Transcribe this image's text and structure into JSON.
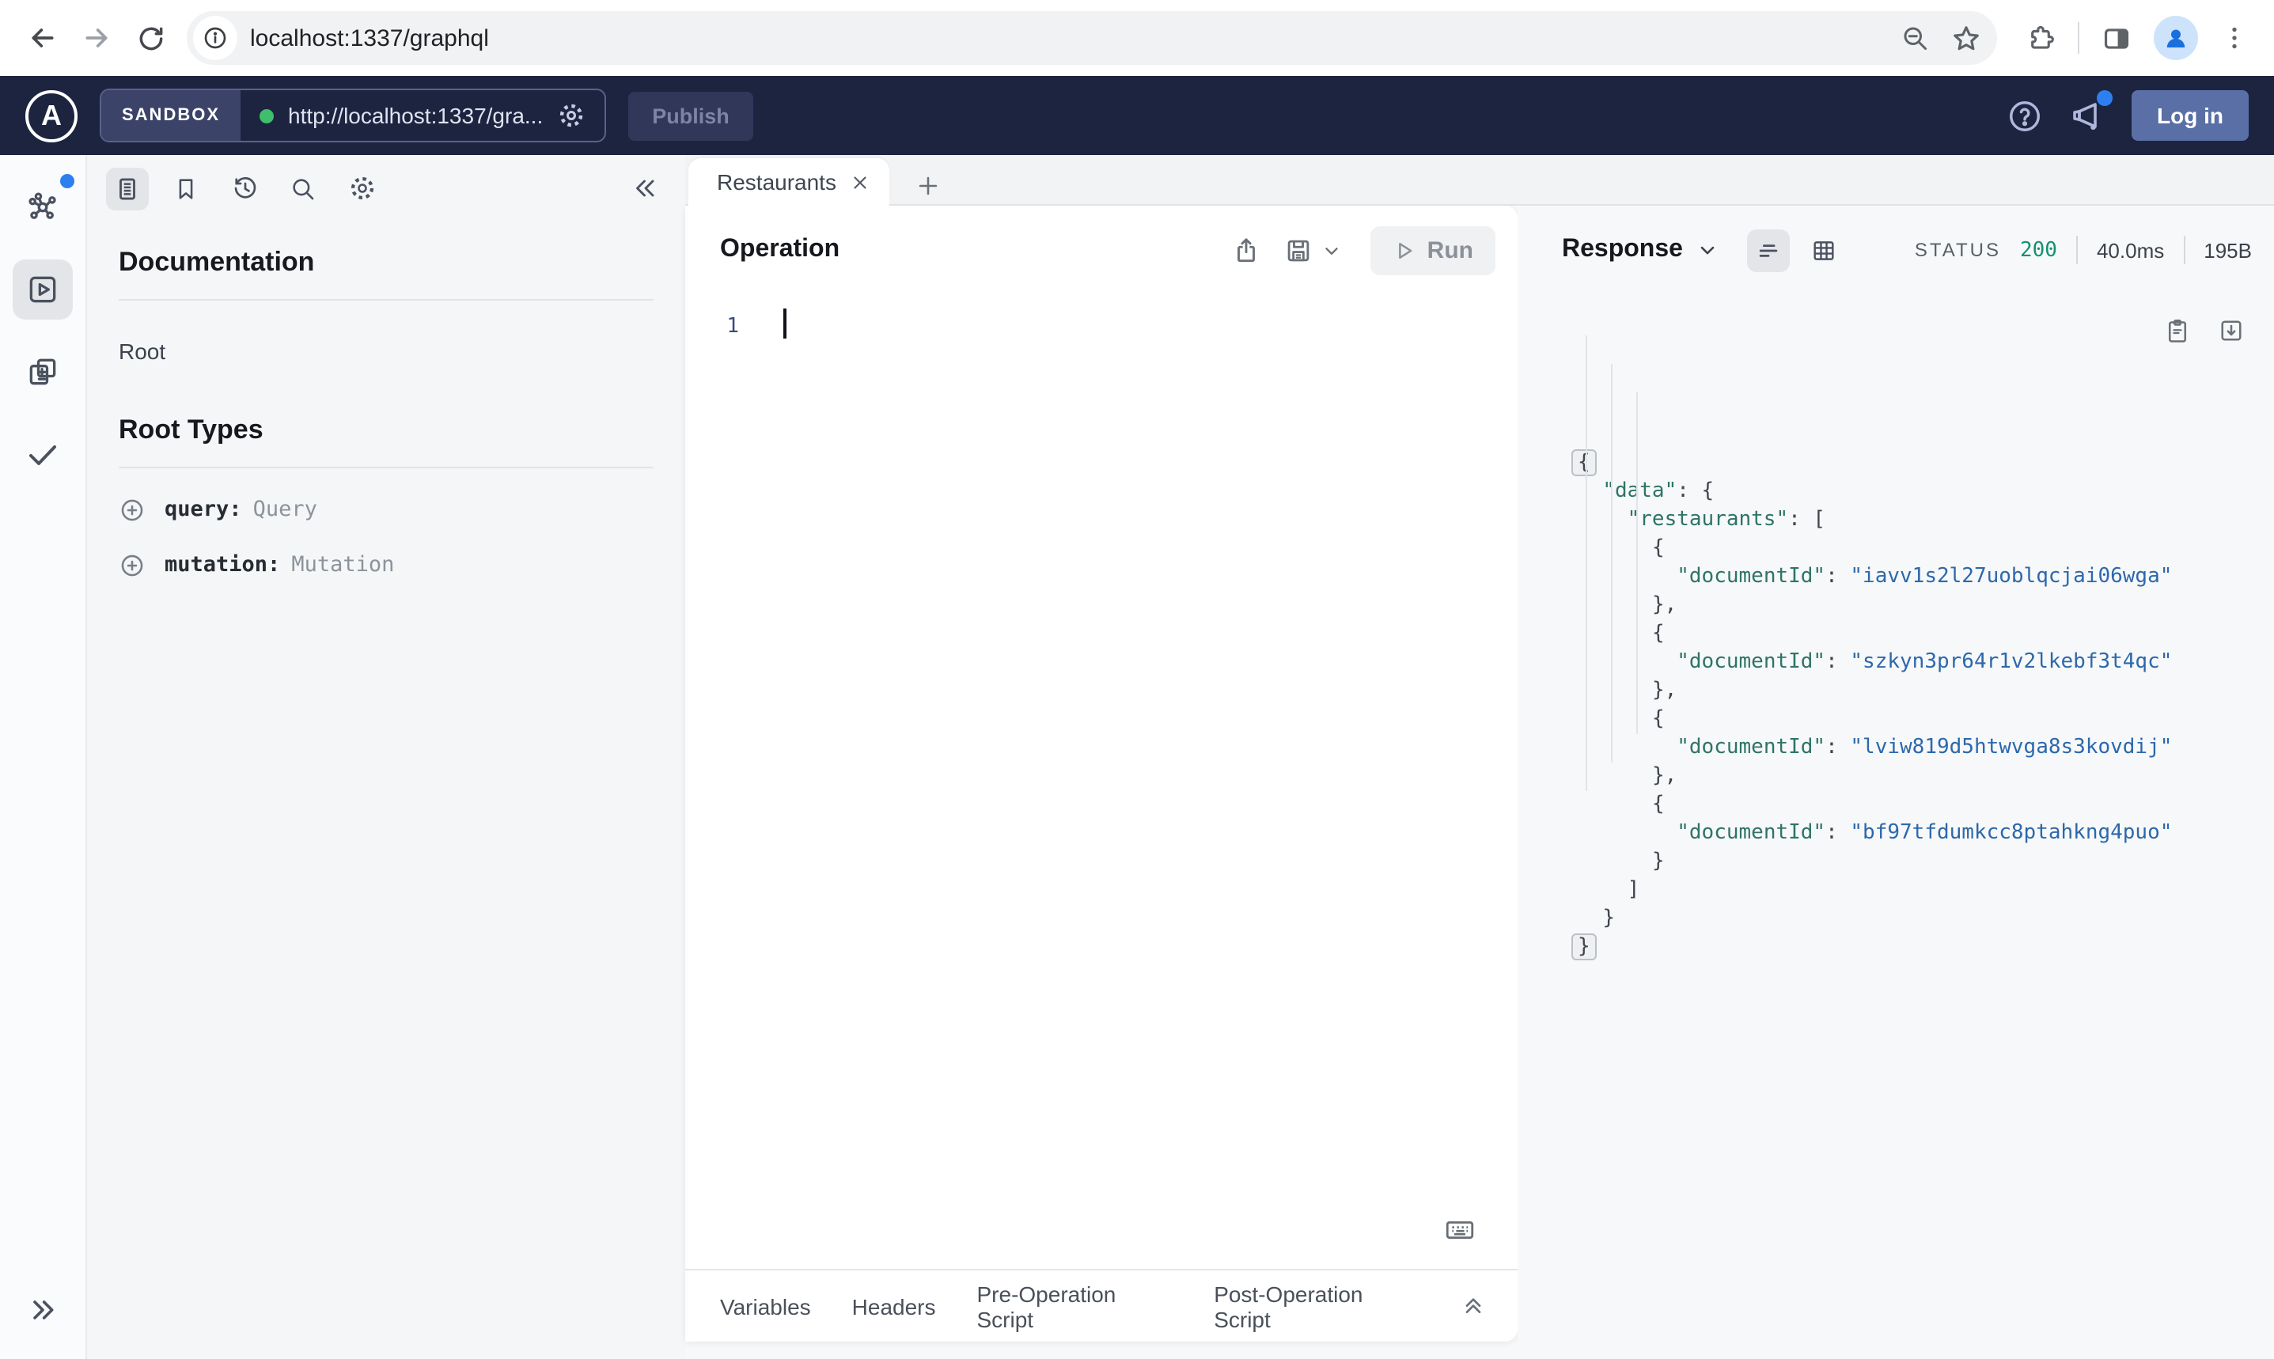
{
  "browser": {
    "url": "localhost:1337/graphql"
  },
  "apollo_toolbar": {
    "sandbox_label": "SANDBOX",
    "endpoint": "http://localhost:1337/gra...",
    "publish_label": "Publish",
    "login_label": "Log in"
  },
  "doc_panel": {
    "title": "Documentation",
    "root_item": "Root",
    "root_types_title": "Root Types",
    "entries": [
      {
        "field": "query:",
        "type": "Query"
      },
      {
        "field": "mutation:",
        "type": "Mutation"
      }
    ]
  },
  "tabs": {
    "active_label": "Restaurants"
  },
  "operation": {
    "title": "Operation",
    "run_label": "Run",
    "line_number": "1"
  },
  "response": {
    "title": "Response",
    "status_label": "STATUS",
    "status_code": "200",
    "duration": "40.0ms",
    "size": "195B",
    "lines": [
      [
        [
          "fold",
          "{"
        ]
      ],
      [
        [
          "pre",
          "  "
        ],
        [
          "key",
          "\"data\""
        ],
        [
          "punc",
          ": {"
        ]
      ],
      [
        [
          "pre",
          "    "
        ],
        [
          "key",
          "\"restaurants\""
        ],
        [
          "punc",
          ": ["
        ]
      ],
      [
        [
          "pre",
          "      "
        ],
        [
          "punc",
          "{"
        ]
      ],
      [
        [
          "pre",
          "        "
        ],
        [
          "key",
          "\"documentId\""
        ],
        [
          "punc",
          ": "
        ],
        [
          "val",
          "\"iavv1s2l27uoblqcjai06wga\""
        ]
      ],
      [
        [
          "pre",
          "      "
        ],
        [
          "punc",
          "},"
        ]
      ],
      [
        [
          "pre",
          "      "
        ],
        [
          "punc",
          "{"
        ]
      ],
      [
        [
          "pre",
          "        "
        ],
        [
          "key",
          "\"documentId\""
        ],
        [
          "punc",
          ": "
        ],
        [
          "val",
          "\"szkyn3pr64r1v2lkebf3t4qc\""
        ]
      ],
      [
        [
          "pre",
          "      "
        ],
        [
          "punc",
          "},"
        ]
      ],
      [
        [
          "pre",
          "      "
        ],
        [
          "punc",
          "{"
        ]
      ],
      [
        [
          "pre",
          "        "
        ],
        [
          "key",
          "\"documentId\""
        ],
        [
          "punc",
          ": "
        ],
        [
          "val",
          "\"lviw819d5htwvga8s3kovdij\""
        ]
      ],
      [
        [
          "pre",
          "      "
        ],
        [
          "punc",
          "},"
        ]
      ],
      [
        [
          "pre",
          "      "
        ],
        [
          "punc",
          "{"
        ]
      ],
      [
        [
          "pre",
          "        "
        ],
        [
          "key",
          "\"documentId\""
        ],
        [
          "punc",
          ": "
        ],
        [
          "val",
          "\"bf97tfdumkcc8ptahkng4puo\""
        ]
      ],
      [
        [
          "pre",
          "      "
        ],
        [
          "punc",
          "}"
        ]
      ],
      [
        [
          "pre",
          "    "
        ],
        [
          "punc",
          "]"
        ]
      ],
      [
        [
          "pre",
          "  "
        ],
        [
          "punc",
          "}"
        ]
      ],
      [
        [
          "fold",
          "}"
        ]
      ]
    ]
  },
  "bottom_tabs": [
    "Variables",
    "Headers",
    "Pre-Operation Script",
    "Post-Operation Script"
  ],
  "colors": {
    "toolbar_navy": "#1d2440",
    "login_blue": "#5a6fa5",
    "notification_blue": "#2d7ff0",
    "endpoint_green_dot": "#3fbe6c",
    "status_green": "#13926f",
    "json_key_teal": "#2e7467",
    "json_value_blue": "#2c68ac"
  },
  "icons": {
    "back": "left-arrow",
    "forward": "right-arrow",
    "reload": "circular-arrow",
    "site_info": "info-circle",
    "zoom_out": "magnifier-minus",
    "bookmark_star": "star",
    "extensions": "puzzle-piece",
    "side_panel": "split-rectangle",
    "profile": "person",
    "menu": "vertical-dots",
    "apollo_logo": "A-in-circle",
    "settings": "gear",
    "help": "question-circle",
    "announcements": "megaphone",
    "schema": "graph-nodes",
    "explorer": "play-square",
    "changesets": "copy-plus-minus",
    "checks": "checkmark",
    "docs": "document-lines",
    "saved": "bookmark",
    "history": "clock-arrow",
    "search": "magnifier",
    "collapse_left": "double-chevron-left",
    "expand_right": "double-chevron-right",
    "share": "box-up-arrow",
    "save": "floppy-disk",
    "run_play": "play-triangle",
    "json_view": "text-lines",
    "table_view": "grid",
    "copy": "clipboard",
    "download": "down-arrow-box",
    "keyboard": "keyboard",
    "collapse_up": "double-chevron-up",
    "expand_type": "plus-circle"
  }
}
